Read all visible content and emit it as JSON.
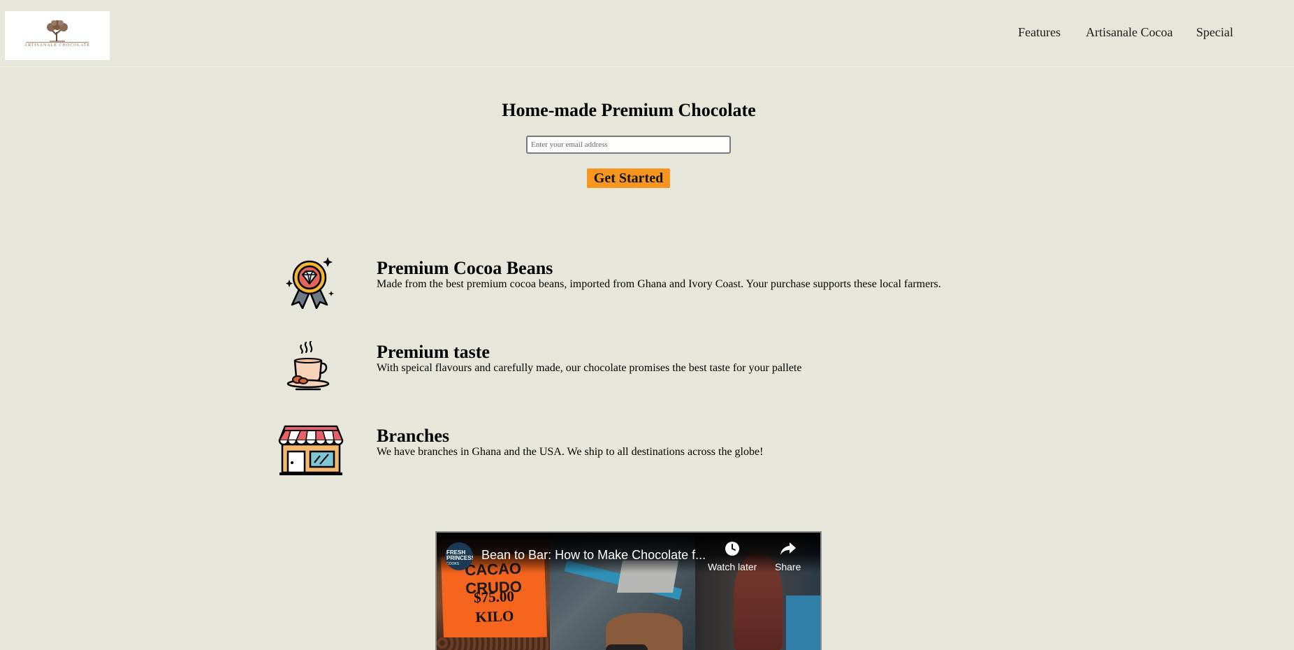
{
  "header": {
    "logo_alt": "Artisanale Chocolate logo",
    "logo_text": "ARTISANALE CHOCOLATE",
    "nav": [
      {
        "label": "Features"
      },
      {
        "label": "Artisanale Cocoa"
      },
      {
        "label": "Special"
      }
    ]
  },
  "hero": {
    "title": "Home-made Premium Chocolate",
    "email_placeholder": "Enter your email address",
    "button_label": "Get Started"
  },
  "features": [
    {
      "icon": "award-medal-icon",
      "heading": "Premium Cocoa Beans",
      "text": "Made from the best premium cocoa beans, imported from Ghana and Ivory Coast. Your purchase supports these local farmers."
    },
    {
      "icon": "coffee-cup-icon",
      "heading": "Premium taste",
      "text": "With speical flavours and carefully made, our chocolate promises the best taste for your pallete"
    },
    {
      "icon": "storefront-icon",
      "heading": "Branches",
      "text": "We have branches in Ghana and the USA. We ship to all destinations across the globe!"
    }
  ],
  "video": {
    "channel_badge_line1": "FRESH",
    "channel_badge_line2": "PRINCESS",
    "channel_badge_line3": "COOKS",
    "title": "Bean to Bar: How to Make Chocolate f...",
    "watch_later": "Watch later",
    "share": "Share",
    "sign_line1": "CACAO CRUDO",
    "sign_line2": "$75.00",
    "sign_line3": "KILO"
  },
  "colors": {
    "background": "#e7e6da",
    "button": "#f7961e"
  }
}
